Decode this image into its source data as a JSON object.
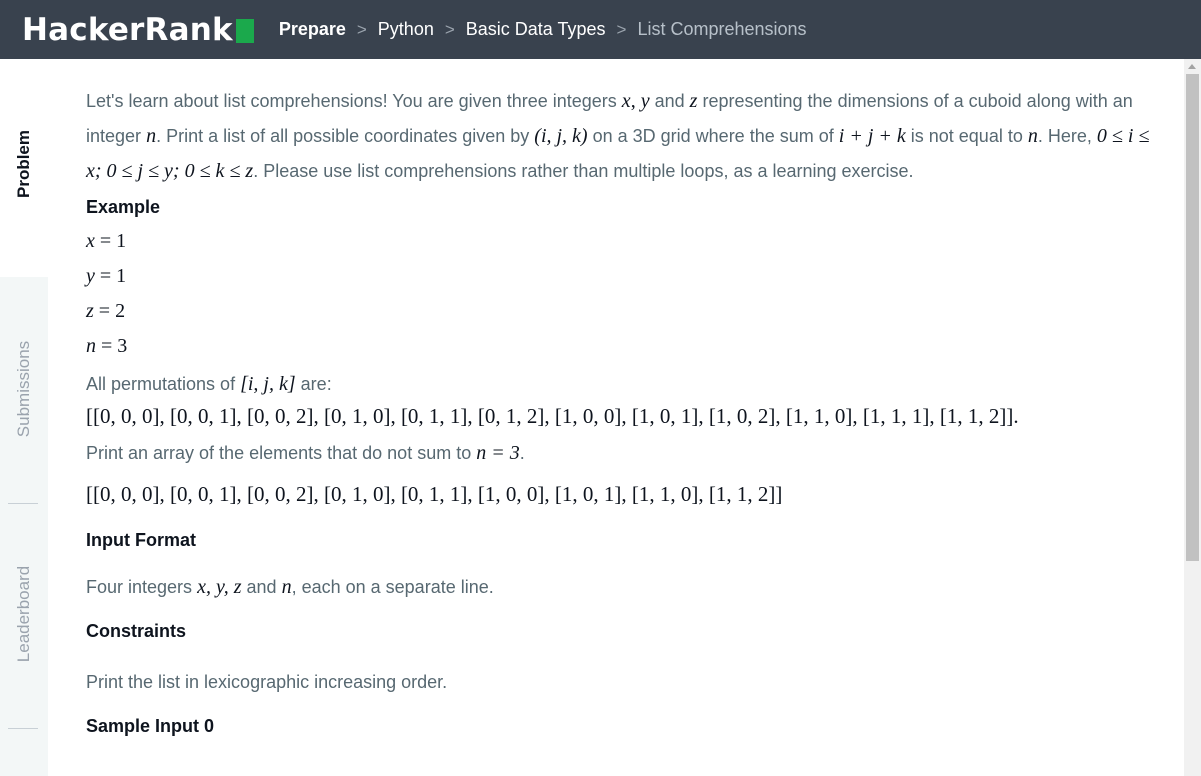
{
  "header": {
    "logo_text": "HackerRank",
    "breadcrumbs": [
      "Prepare",
      "Python",
      "Basic Data Types",
      "List Comprehensions"
    ],
    "separator": ">"
  },
  "sidebar": {
    "tabs": [
      "Problem",
      "Submissions",
      "Leaderboard"
    ],
    "active_tab": "Problem"
  },
  "problem": {
    "intro": {
      "p1": "Let's learn about list comprehensions! You are given three integers",
      "x": "x",
      "comma": ",",
      "y": "y",
      "and": "and",
      "z": "z",
      "p2": "representing the dimensions of a cuboid along with an integer",
      "n": "n",
      "p3": ". Print a list of all possible coordinates given by",
      "ijk": "(i, j, k)",
      "p4": "on a 3D grid where the sum of",
      "sum": "i + j + k",
      "p5": "is not equal to",
      "p6": ".",
      "here": "Here,",
      "range": "0 ≤ i ≤ x; 0 ≤ j ≤ y; 0 ≤ k ≤ z",
      "p7": ". Please use list comprehensions rather than multiple loops, as a learning exercise."
    },
    "example_heading": "Example",
    "example_vars": [
      {
        "var": "x",
        "eq": " = ",
        "val": "1"
      },
      {
        "var": "y",
        "eq": " = ",
        "val": "1"
      },
      {
        "var": "z",
        "eq": " = ",
        "val": "2"
      },
      {
        "var": "n",
        "eq": " = ",
        "val": "3"
      }
    ],
    "perm_text": "All permutations of",
    "perm_ijk": "[i, j, k]",
    "perm_are": "are:",
    "all_perms": "[[0, 0, 0], [0, 0, 1], [0, 0, 2], [0, 1, 0], [0, 1, 1], [0, 1, 2], [1, 0, 0], [1, 0, 1], [1, 0, 2], [1, 1, 0], [1, 1, 1], [1, 1, 2]].",
    "print_text": "Print an array of the elements that do not sum to",
    "print_eq": "n = 3",
    "print_dot": ".",
    "result": "[[0, 0, 0], [0, 0, 1], [0, 0, 2], [0, 1, 0], [0, 1, 1], [1, 0, 0], [1, 0, 1], [1, 1, 0], [1, 1, 2]]",
    "input_format_heading": "Input Format",
    "input_text1": "Four integers",
    "input_vars": "x, y, z",
    "input_and": "and",
    "input_n": "n",
    "input_text2": ", each on a separate line.",
    "constraints_heading": "Constraints",
    "constraints_text": "Print the list in lexicographic increasing order.",
    "sample_input_heading": "Sample Input 0"
  },
  "colors": {
    "topbar": "#39424e",
    "logo_accent": "#1ba94c",
    "text": "#576871",
    "heading": "#0e141e"
  }
}
